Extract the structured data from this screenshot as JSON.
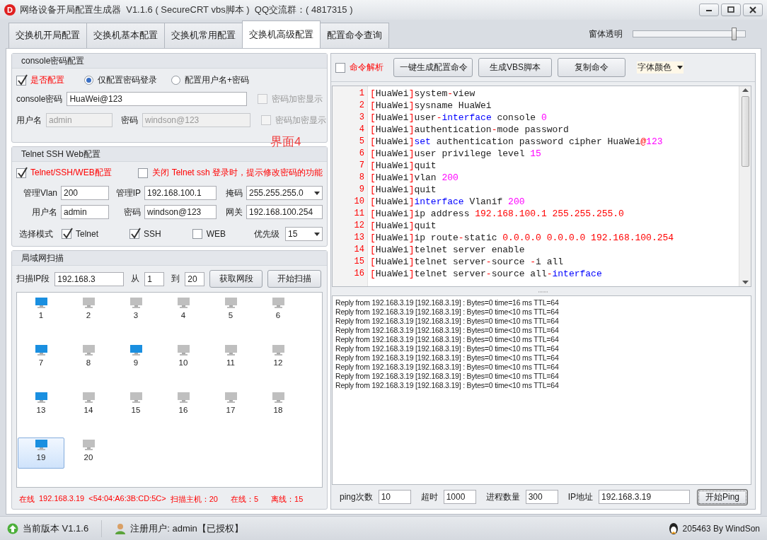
{
  "window": {
    "logo": "D",
    "title": "网络设备开局配置生成器  V1.1.6 ( SecureCRT vbs脚本 )  QQ交流群：( 4817315 )"
  },
  "tabs": [
    {
      "label": "交换机开局配置",
      "selected": false
    },
    {
      "label": "交换机基本配置",
      "selected": false
    },
    {
      "label": "交换机常用配置",
      "selected": false
    },
    {
      "label": "交换机高级配置",
      "selected": true
    },
    {
      "label": "配置命令查询",
      "selected": false
    }
  ],
  "opacity": {
    "label": "窗体透明",
    "level": 0.9
  },
  "console_group": {
    "title": "console密码配置",
    "enable": {
      "label": "是否配置",
      "checked": true
    },
    "modes": [
      {
        "label": "仅配置密码登录",
        "selected": true
      },
      {
        "label": "配置用户名+密码",
        "selected": false
      }
    ],
    "password": {
      "label": "console密码",
      "value": "HuaWei@123"
    },
    "encrypt_1": {
      "label": "密码加密显示",
      "checked": false,
      "disabled": true
    },
    "username": {
      "label": "用户名",
      "value": "admin",
      "disabled": true
    },
    "user_password": {
      "label": "密码",
      "value": "windson@123",
      "disabled": true
    },
    "encrypt_2": {
      "label": "密码加密显示",
      "checked": false,
      "disabled": true
    }
  },
  "annotation": "界面4",
  "telnet_group": {
    "title": "Telnet SSH Web配置",
    "enable": {
      "label": "Telnet/SSH/WEB配置",
      "checked": true
    },
    "prompt_option": {
      "label": "关闭 Telnet ssh 登录时，提示修改密码的功能",
      "checked": false
    },
    "fields": [
      {
        "label": "管理Vlan",
        "value": "200",
        "kind": "input"
      },
      {
        "label": "管理IP",
        "value": "192.168.100.1",
        "kind": "input"
      },
      {
        "label": "掩码",
        "value": "255.255.255.0",
        "kind": "select"
      },
      {
        "label": "用户名",
        "value": "admin",
        "kind": "input"
      },
      {
        "label": "密码",
        "value": "windson@123",
        "kind": "input"
      },
      {
        "label": "网关",
        "value": "192.168.100.254",
        "kind": "input"
      }
    ],
    "mode_label": "选择模式",
    "modes": [
      {
        "label": "Telnet",
        "checked": true
      },
      {
        "label": "SSH",
        "checked": true
      },
      {
        "label": "WEB",
        "checked": false
      }
    ],
    "priority": {
      "label": "优先级",
      "value": "15"
    }
  },
  "scan_group": {
    "title": "局域网扫描",
    "range_label": "扫描IP段",
    "range": "192.168.3",
    "from_label": "从",
    "from": "1",
    "to_label": "到",
    "to": "20",
    "buttons": [
      "获取网段",
      "开始扫描"
    ],
    "hosts": [
      {
        "label": "1",
        "online": true,
        "selected": false
      },
      {
        "label": "2",
        "online": false,
        "selected": false
      },
      {
        "label": "3",
        "online": false,
        "selected": false
      },
      {
        "label": "4",
        "online": false,
        "selected": false
      },
      {
        "label": "5",
        "online": false,
        "selected": false
      },
      {
        "label": "6",
        "online": false,
        "selected": false
      },
      {
        "label": "7",
        "online": true,
        "selected": false
      },
      {
        "label": "8",
        "online": false,
        "selected": false
      },
      {
        "label": "9",
        "online": true,
        "selected": false
      },
      {
        "label": "10",
        "online": false,
        "selected": false
      },
      {
        "label": "11",
        "online": false,
        "selected": false
      },
      {
        "label": "12",
        "online": false,
        "selected": false
      },
      {
        "label": "13",
        "online": true,
        "selected": false
      },
      {
        "label": "14",
        "online": false,
        "selected": false
      },
      {
        "label": "15",
        "online": false,
        "selected": false
      },
      {
        "label": "16",
        "online": false,
        "selected": false
      },
      {
        "label": "17",
        "online": false,
        "selected": false
      },
      {
        "label": "18",
        "online": false,
        "selected": false
      },
      {
        "label": "19",
        "online": true,
        "selected": true
      },
      {
        "label": "20",
        "online": false,
        "selected": false
      }
    ],
    "status": [
      "在线",
      "192.168.3.19",
      "<54:04:A6:3B:CD:5C>",
      "扫描主机：20",
      "在线：5",
      "离线：15"
    ]
  },
  "command_panel": {
    "parse": {
      "label": "命令解析",
      "checked": false
    },
    "buttons": [
      "一键生成配置命令",
      "生成VBS脚本",
      "复制命令"
    ],
    "font_color": "字体颜色",
    "lines": [
      {
        "number": "1",
        "segments": [
          {
            "kind": "punct",
            "text": "["
          },
          {
            "kind": "plain",
            "text": "HuaWei"
          },
          {
            "kind": "punct",
            "text": "]"
          },
          {
            "kind": "plain",
            "text": "system"
          },
          {
            "kind": "punct",
            "text": "-"
          },
          {
            "kind": "plain",
            "text": "view"
          }
        ]
      },
      {
        "number": "2",
        "segments": [
          {
            "kind": "punct",
            "text": "["
          },
          {
            "kind": "plain",
            "text": "HuaWei"
          },
          {
            "kind": "punct",
            "text": "]"
          },
          {
            "kind": "plain",
            "text": "sysname HuaWei"
          }
        ]
      },
      {
        "number": "3",
        "segments": [
          {
            "kind": "punct",
            "text": "["
          },
          {
            "kind": "plain",
            "text": "HuaWei"
          },
          {
            "kind": "punct",
            "text": "]"
          },
          {
            "kind": "plain",
            "text": "user"
          },
          {
            "kind": "punct",
            "text": "-"
          },
          {
            "kind": "keyword",
            "text": "interface"
          },
          {
            "kind": "plain",
            "text": " console "
          },
          {
            "kind": "number",
            "text": "0"
          }
        ]
      },
      {
        "number": "4",
        "segments": [
          {
            "kind": "punct",
            "text": "["
          },
          {
            "kind": "plain",
            "text": "HuaWei"
          },
          {
            "kind": "punct",
            "text": "]"
          },
          {
            "kind": "plain",
            "text": "authentication"
          },
          {
            "kind": "punct",
            "text": "-"
          },
          {
            "kind": "plain",
            "text": "mode password"
          }
        ]
      },
      {
        "number": "5",
        "segments": [
          {
            "kind": "punct",
            "text": "["
          },
          {
            "kind": "plain",
            "text": "HuaWei"
          },
          {
            "kind": "punct",
            "text": "]"
          },
          {
            "kind": "keyword",
            "text": "set"
          },
          {
            "kind": "plain",
            "text": " authentication password cipher HuaWei"
          },
          {
            "kind": "punct",
            "text": "@"
          },
          {
            "kind": "number",
            "text": "123"
          }
        ]
      },
      {
        "number": "6",
        "segments": [
          {
            "kind": "punct",
            "text": "["
          },
          {
            "kind": "plain",
            "text": "HuaWei"
          },
          {
            "kind": "punct",
            "text": "]"
          },
          {
            "kind": "plain",
            "text": "user privilege level "
          },
          {
            "kind": "number",
            "text": "15"
          }
        ]
      },
      {
        "number": "7",
        "segments": [
          {
            "kind": "punct",
            "text": "["
          },
          {
            "kind": "plain",
            "text": "HuaWei"
          },
          {
            "kind": "punct",
            "text": "]"
          },
          {
            "kind": "plain",
            "text": "quit"
          }
        ]
      },
      {
        "number": "8",
        "segments": [
          {
            "kind": "punct",
            "text": "["
          },
          {
            "kind": "plain",
            "text": "HuaWei"
          },
          {
            "kind": "punct",
            "text": "]"
          },
          {
            "kind": "plain",
            "text": "vlan "
          },
          {
            "kind": "number",
            "text": "200"
          }
        ]
      },
      {
        "number": "9",
        "segments": [
          {
            "kind": "punct",
            "text": "["
          },
          {
            "kind": "plain",
            "text": "HuaWei"
          },
          {
            "kind": "punct",
            "text": "]"
          },
          {
            "kind": "plain",
            "text": "quit"
          }
        ]
      },
      {
        "number": "10",
        "segments": [
          {
            "kind": "punct",
            "text": "["
          },
          {
            "kind": "plain",
            "text": "HuaWei"
          },
          {
            "kind": "punct",
            "text": "]"
          },
          {
            "kind": "keyword",
            "text": "interface"
          },
          {
            "kind": "plain",
            "text": " Vlanif "
          },
          {
            "kind": "number",
            "text": "200"
          }
        ]
      },
      {
        "number": "11",
        "segments": [
          {
            "kind": "punct",
            "text": "["
          },
          {
            "kind": "plain",
            "text": "HuaWei"
          },
          {
            "kind": "punct",
            "text": "]"
          },
          {
            "kind": "plain",
            "text": "ip address "
          },
          {
            "kind": "address",
            "text": "192.168.100.1 255.255.255.0"
          }
        ]
      },
      {
        "number": "12",
        "segments": [
          {
            "kind": "punct",
            "text": "["
          },
          {
            "kind": "plain",
            "text": "HuaWei"
          },
          {
            "kind": "punct",
            "text": "]"
          },
          {
            "kind": "plain",
            "text": "quit"
          }
        ]
      },
      {
        "number": "13",
        "segments": [
          {
            "kind": "punct",
            "text": "["
          },
          {
            "kind": "plain",
            "text": "HuaWei"
          },
          {
            "kind": "punct",
            "text": "]"
          },
          {
            "kind": "plain",
            "text": "ip route"
          },
          {
            "kind": "punct",
            "text": "-"
          },
          {
            "kind": "plain",
            "text": "static "
          },
          {
            "kind": "address",
            "text": "0.0.0.0 0.0.0.0 192.168.100.254"
          }
        ]
      },
      {
        "number": "14",
        "segments": [
          {
            "kind": "punct",
            "text": "["
          },
          {
            "kind": "plain",
            "text": "HuaWei"
          },
          {
            "kind": "punct",
            "text": "]"
          },
          {
            "kind": "plain",
            "text": "telnet server enable"
          }
        ]
      },
      {
        "number": "15",
        "segments": [
          {
            "kind": "punct",
            "text": "["
          },
          {
            "kind": "plain",
            "text": "HuaWei"
          },
          {
            "kind": "punct",
            "text": "]"
          },
          {
            "kind": "plain",
            "text": "telnet server"
          },
          {
            "kind": "punct",
            "text": "-"
          },
          {
            "kind": "plain",
            "text": "source "
          },
          {
            "kind": "punct",
            "text": "-"
          },
          {
            "kind": "plain",
            "text": "i all"
          }
        ]
      },
      {
        "number": "16",
        "segments": [
          {
            "kind": "punct",
            "text": "["
          },
          {
            "kind": "plain",
            "text": "HuaWei"
          },
          {
            "kind": "punct",
            "text": "]"
          },
          {
            "kind": "plain",
            "text": "telnet server"
          },
          {
            "kind": "punct",
            "text": "-"
          },
          {
            "kind": "plain",
            "text": "source all"
          },
          {
            "kind": "punct",
            "text": "-"
          },
          {
            "kind": "keyword",
            "text": "interface"
          }
        ]
      }
    ]
  },
  "ping_panel": {
    "output": [
      "Reply from 192.168.3.19 [192.168.3.19] : Bytes=0 time=16 ms TTL=64",
      "Reply from 192.168.3.19 [192.168.3.19] : Bytes=0 time<10 ms TTL=64",
      "Reply from 192.168.3.19 [192.168.3.19] : Bytes=0 time<10 ms TTL=64",
      "Reply from 192.168.3.19 [192.168.3.19] : Bytes=0 time<10 ms TTL=64",
      "Reply from 192.168.3.19 [192.168.3.19] : Bytes=0 time<10 ms TTL=64",
      "Reply from 192.168.3.19 [192.168.3.19] : Bytes=0 time<10 ms TTL=64",
      "Reply from 192.168.3.19 [192.168.3.19] : Bytes=0 time<10 ms TTL=64",
      "Reply from 192.168.3.19 [192.168.3.19] : Bytes=0 time<10 ms TTL=64",
      "Reply from 192.168.3.19 [192.168.3.19] : Bytes=0 time<10 ms TTL=64",
      "Reply from 192.168.3.19 [192.168.3.19] : Bytes=0 time<10 ms TTL=64"
    ],
    "fields": [
      {
        "label": "ping次数",
        "value": "10"
      },
      {
        "label": "超时",
        "value": "1000"
      },
      {
        "label": "进程数量",
        "value": "300"
      },
      {
        "label": "IP地址",
        "value": "192.168.3.19"
      }
    ],
    "button": "开始Ping"
  },
  "status_bar": {
    "version": "当前版本 V1.1.6",
    "user": "注册用户: admin【已授权】",
    "credit": "205463 By WindSon"
  }
}
